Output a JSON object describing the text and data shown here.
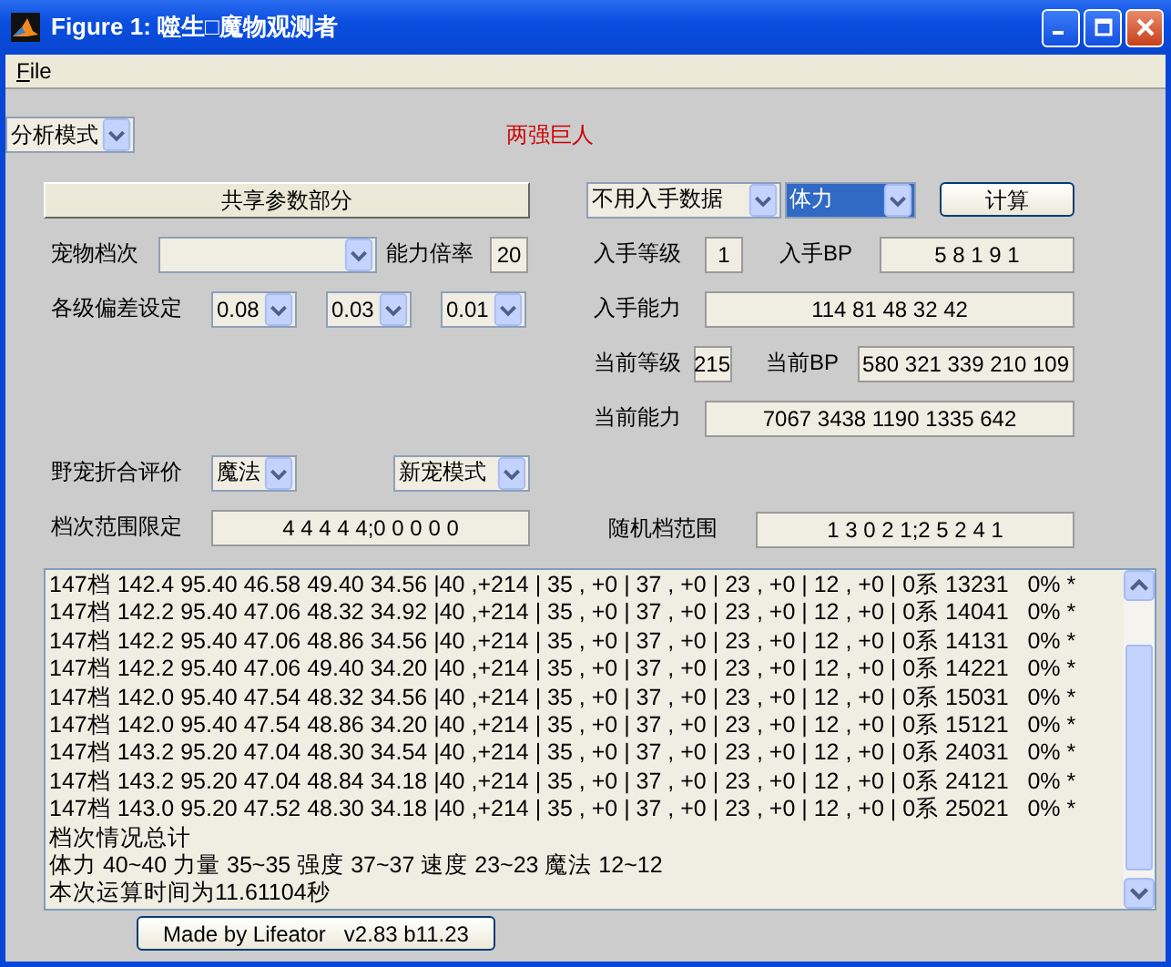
{
  "window": {
    "title": "Figure 1: 噬生□魔物观测者"
  },
  "menu": [
    {
      "label": "File",
      "first_letter_underlined": true
    }
  ],
  "mode_select": {
    "value": "分析模式"
  },
  "banner": "两强巨人",
  "left_panel": {
    "shared_button": "共享参数部分",
    "pet_grade": {
      "label": "宠物档次"
    },
    "ability_rate": {
      "label": "能力倍率",
      "value": "20"
    },
    "deviation": {
      "label": "各级偏差设定",
      "selects": [
        "0.08",
        "0.03",
        "0.01"
      ]
    },
    "wild_rating": {
      "label": "野宠折合评价",
      "attribute": "魔法",
      "mode": "新宠模式"
    },
    "grade_range": {
      "label": "档次范围限定",
      "value": "4 4 4 4 4;0 0 0 0 0"
    }
  },
  "right_panel": {
    "data_source": {
      "value": "不用入手数据",
      "focused": false
    },
    "stat_select": {
      "value": "体力",
      "focused": true
    },
    "compute_button": "计算",
    "obtain_level": {
      "label": "入手等级",
      "value": "1"
    },
    "obtain_bp": {
      "label": "入手BP",
      "value": "5 8 1 9 1"
    },
    "obtain_ability": {
      "label": "入手能力",
      "value": "114 81 48 32 42"
    },
    "current_level": {
      "label": "当前等级",
      "value": "215"
    },
    "current_bp": {
      "label": "当前BP",
      "value": "580 321 339 210 109"
    },
    "current_ability": {
      "label": "当前能力",
      "value": "7067 3438 1190 1335 642"
    },
    "random_range": {
      "label": "随机档范围",
      "value": "1 3 0 2 1;2 5 2 4 1"
    }
  },
  "output_lines": [
    "147档 142.4 95.40 46.58 49.40 34.56 |40 ,+214 | 35 , +0 | 37 , +0 | 23 , +0 | 12 , +0 | 0系 13231   0% *",
    "147档 142.2 95.40 47.06 48.32 34.92 |40 ,+214 | 35 , +0 | 37 , +0 | 23 , +0 | 12 , +0 | 0系 14041   0% *",
    "147档 142.2 95.40 47.06 48.86 34.56 |40 ,+214 | 35 , +0 | 37 , +0 | 23 , +0 | 12 , +0 | 0系 14131   0% *",
    "147档 142.2 95.40 47.06 49.40 34.20 |40 ,+214 | 35 , +0 | 37 , +0 | 23 , +0 | 12 , +0 | 0系 14221   0% *",
    "147档 142.0 95.40 47.54 48.32 34.56 |40 ,+214 | 35 , +0 | 37 , +0 | 23 , +0 | 12 , +0 | 0系 15031   0% *",
    "147档 142.0 95.40 47.54 48.86 34.20 |40 ,+214 | 35 , +0 | 37 , +0 | 23 , +0 | 12 , +0 | 0系 15121   0% *",
    "147档 143.2 95.20 47.04 48.30 34.54 |40 ,+214 | 35 , +0 | 37 , +0 | 23 , +0 | 12 , +0 | 0系 24031   0% *",
    "147档 143.2 95.20 47.04 48.84 34.18 |40 ,+214 | 35 , +0 | 37 , +0 | 23 , +0 | 12 , +0 | 0系 24121   0% *",
    "147档 143.0 95.20 47.52 48.30 34.18 |40 ,+214 | 35 , +0 | 37 , +0 | 23 , +0 | 12 , +0 | 0系 25021   0% *",
    "档次情况总计",
    "体力 40~40 力量 35~35 强度 37~37 速度 23~23 魔法 12~12",
    "本次运算时间为11.61104秒"
  ],
  "credit_button": "Made by Lifeator   v2.83 b11.23"
}
